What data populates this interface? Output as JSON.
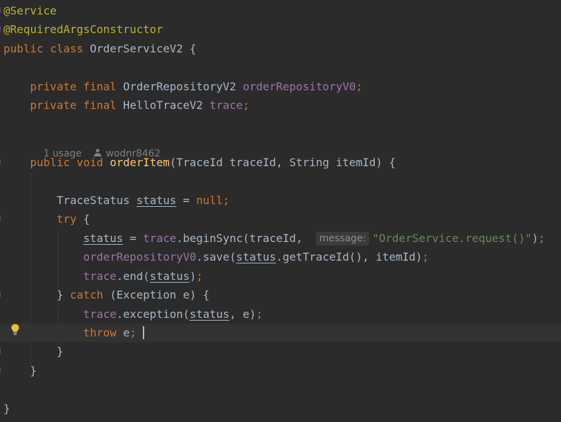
{
  "code": {
    "annotation_service": "@Service",
    "annotation_rac": "@RequiredArgsConstructor",
    "kw_public": "public",
    "kw_class": "class",
    "kw_private": "private",
    "kw_final": "final",
    "kw_void": "void",
    "kw_null": "null",
    "kw_try": "try",
    "kw_catch": "catch",
    "kw_throw": "throw",
    "class_name": "OrderServiceV2",
    "type_repo": "OrderRepositoryV2",
    "field_repo": "orderRepositoryV0",
    "type_trace": "HelloTraceV2",
    "field_trace": "trace",
    "method_name": "orderItem",
    "params": "(TraceId traceId, String itemId)",
    "type_status": "TraceStatus",
    "var_status": "status",
    "call_begin_sync": ".beginSync(traceId,",
    "hint_message": "message:",
    "string_literal": "\"OrderService.request()\"",
    "call_save": ".save(",
    "call_get_trace_id": ".getTraceId(), itemId)",
    "call_end": ".end(",
    "call_exception": ".exception(",
    "catch_params": "(Exception e) {",
    "var_e": "e",
    "comma_e": ", e)"
  },
  "code_lens": {
    "usages": "1 usage",
    "author": "wodnr8462"
  },
  "icons": {
    "gutter": "lightbulb-icon",
    "lens": "person-icon"
  },
  "colors": {
    "background": "#2b2b2b",
    "keyword": "#cc7832",
    "annotation": "#bbb529",
    "field": "#9876aa",
    "method": "#ffc66d",
    "string": "#6a8759",
    "text": "#a9b7c6"
  }
}
